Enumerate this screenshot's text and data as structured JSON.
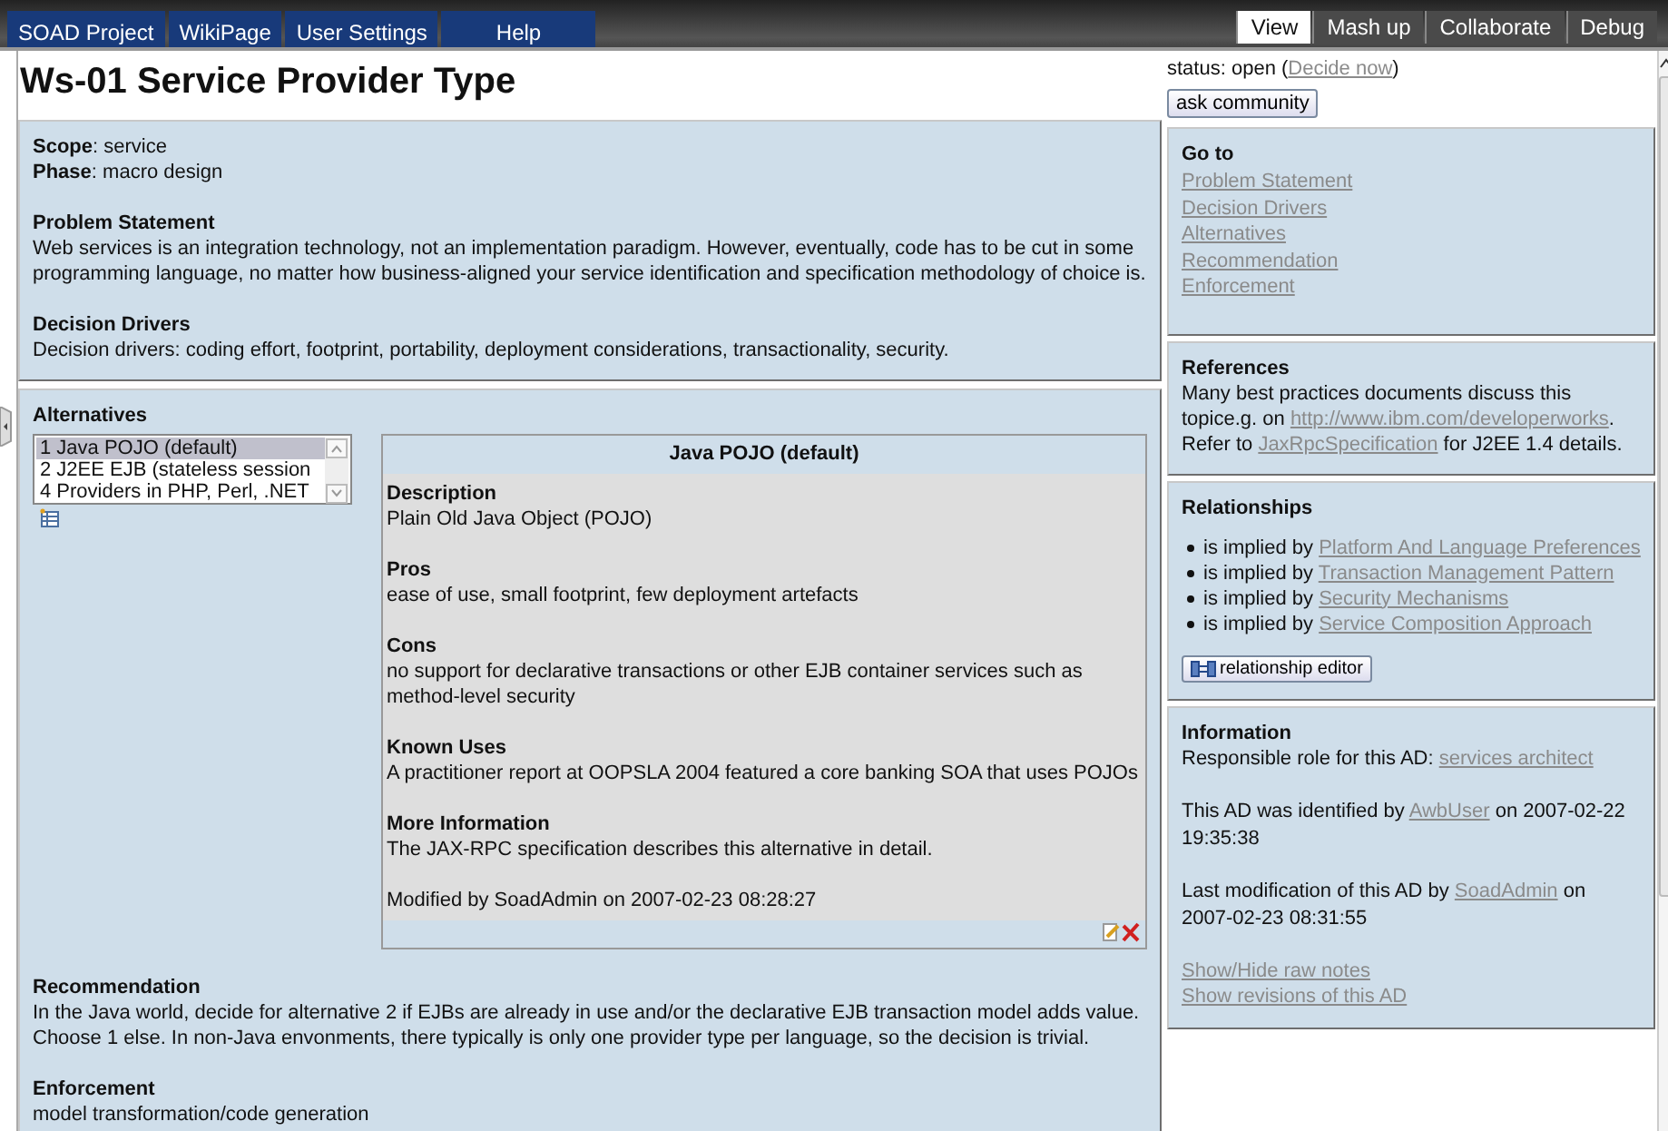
{
  "menu": [
    "SOAD Project",
    "WikiPage",
    "User Settings",
    "Help"
  ],
  "view_tabs": [
    {
      "label": "View",
      "selected": true
    },
    {
      "label": "Mash up",
      "selected": false
    },
    {
      "label": "Collaborate",
      "selected": false
    },
    {
      "label": "Debug",
      "selected": false
    }
  ],
  "title": "Ws-01 Service Provider Type",
  "status": {
    "parts": [
      {
        "text": "status: open ("
      },
      {
        "link": "Decide now"
      },
      {
        "text": ")"
      }
    ],
    "button": "ask community"
  },
  "overview": {
    "fields": [
      {
        "label": "Scope",
        "value": ": service"
      },
      {
        "label": "Phase",
        "value": ": macro design"
      }
    ],
    "sections": [
      {
        "heading": "Problem Statement",
        "text": "Web services is an integration technology, not an implementation paradigm. However, eventually, code has to be cut in some programming language, no matter how business-aligned your service identification and specification methodology of choice is."
      },
      {
        "heading": "Decision Drivers",
        "text": "Decision drivers: coding effort, footprint, portability, deployment considerations, transactionality, security."
      }
    ]
  },
  "alternatives": {
    "heading": "Alternatives",
    "options": [
      {
        "label": "1 Java POJO (default)",
        "selected": true
      },
      {
        "label": "2 J2EE EJB (stateless session",
        "selected": false
      },
      {
        "label": "4 Providers in PHP, Perl, .NET",
        "selected": false
      }
    ],
    "detail": {
      "title": "Java POJO (default)",
      "sections": [
        {
          "heading": "Description",
          "text": "Plain Old Java Object (POJO)"
        },
        {
          "heading": "Pros",
          "text": "ease of use, small footprint, few deployment artefacts"
        },
        {
          "heading": "Cons",
          "text": "no support for declarative transactions or other EJB container services such as method-level security"
        },
        {
          "heading": "Known Uses",
          "text": "A practitioner report at OOPSLA 2004 featured a core banking SOA that uses POJOs"
        },
        {
          "heading": "More Information",
          "text": "The JAX-RPC specification describes this alternative in detail."
        }
      ],
      "modified": "Modified by SoadAdmin on 2007-02-23 08:28:27"
    }
  },
  "closing_sections": [
    {
      "heading": "Recommendation",
      "text": "In the Java world, decide for alternative 2 if EJBs are already in use and/or the declarative EJB transaction model adds value. Choose 1 else. In non-Java envonments, there typically is only one provider type per language, so the decision is trivial."
    },
    {
      "heading": "Enforcement",
      "text": "model transformation/code generation"
    }
  ],
  "goto": {
    "heading": "Go to",
    "links": [
      "Problem Statement",
      "Decision Drivers",
      "Alternatives",
      "Recommendation",
      "Enforcement"
    ]
  },
  "references": {
    "heading": "References",
    "parts": [
      {
        "text": "Many best practices documents discuss this topice.g. on "
      },
      {
        "link": "http://www.ibm.com/developerworks"
      },
      {
        "text": ". Refer to "
      },
      {
        "link": "JaxRpcSpecification"
      },
      {
        "text": " for J2EE 1.4 details."
      }
    ]
  },
  "relationships": {
    "heading": "Relationships",
    "items": [
      {
        "relation": "is implied by",
        "link": "Platform And Language Preferences"
      },
      {
        "relation": "is implied by",
        "link": "Transaction Management Pattern"
      },
      {
        "relation": "is implied by",
        "link": "Security Mechanisms"
      },
      {
        "relation": "is implied by",
        "link": "Service Composition Approach"
      }
    ],
    "button": "relationship editor"
  },
  "information": {
    "heading": "Information",
    "paragraphs": [
      [
        {
          "text": "Responsible role for this AD: "
        },
        {
          "link": "services architect"
        }
      ],
      [
        {
          "text": "This AD was identified by "
        },
        {
          "link": "AwbUser"
        },
        {
          "text": " on 2007-02-22 19:35:38"
        }
      ],
      [
        {
          "text": "Last modification of this AD by "
        },
        {
          "link": "SoadAdmin"
        },
        {
          "text": " on 2007-02-23 08:31:55"
        }
      ]
    ],
    "links": [
      "Show/Hide raw notes",
      "Show revisions of this AD"
    ]
  }
}
